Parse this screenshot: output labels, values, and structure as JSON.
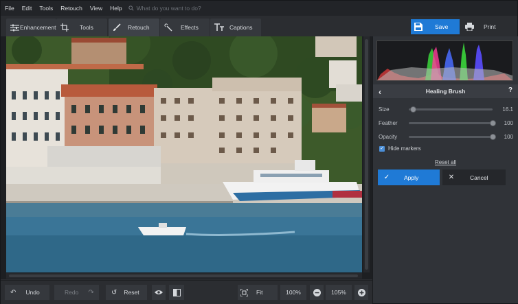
{
  "menu": {
    "items": [
      "File",
      "Edit",
      "Tools",
      "Retouch",
      "View",
      "Help"
    ],
    "search_placeholder": "What do you want to do?"
  },
  "tabs": [
    {
      "label": "Enhancement",
      "icon": "sliders-icon",
      "active": false
    },
    {
      "label": "Tools",
      "icon": "crop-icon",
      "active": false
    },
    {
      "label": "Retouch",
      "icon": "brush-icon",
      "active": true
    },
    {
      "label": "Effects",
      "icon": "magic-wand-icon",
      "active": false
    },
    {
      "label": "Captions",
      "icon": "text-icon",
      "active": false
    }
  ],
  "actions": {
    "save": "Save",
    "print": "Print"
  },
  "panel": {
    "title": "Healing Brush",
    "help": "?",
    "sliders": [
      {
        "label": "Size",
        "value": "16.1",
        "level": 0.05
      },
      {
        "label": "Feather",
        "value": "100",
        "level": 1.0
      },
      {
        "label": "Opacity",
        "value": "100",
        "level": 1.0
      }
    ],
    "hide_markers": {
      "label": "Hide markers",
      "checked": true
    },
    "reset_all": "Reset all",
    "apply": "Apply",
    "cancel": "Cancel"
  },
  "bottom": {
    "undo": "Undo",
    "redo": "Redo",
    "reset": "Reset",
    "fit": "Fit",
    "zoom_100": "100%",
    "zoom_current": "105%"
  },
  "colors": {
    "accent": "#1f7ad6",
    "background": "#2b2d31",
    "panel": "#303338"
  }
}
